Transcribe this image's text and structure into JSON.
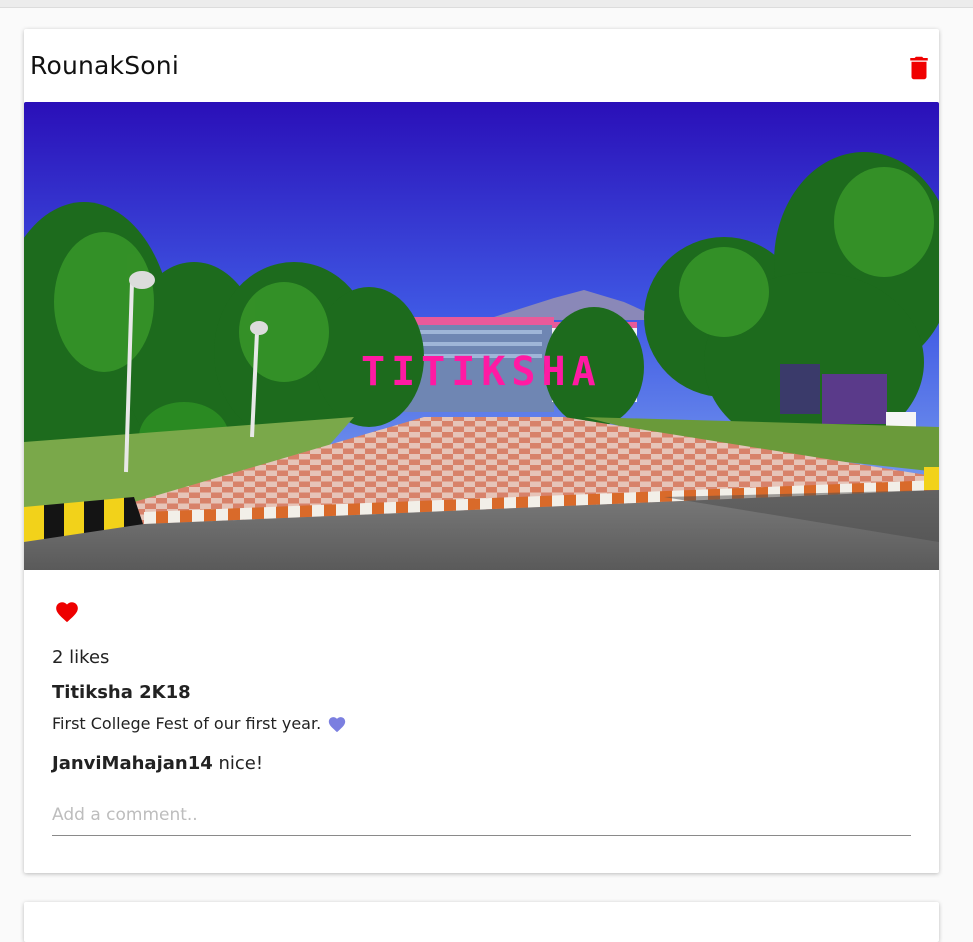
{
  "post": {
    "username": "RounakSoni",
    "photo_sign_text": "TITIKSHA",
    "likes_text": "2 likes",
    "caption_title": "Titiksha 2K18",
    "caption_text": "First College Fest of our first year.",
    "comments": [
      {
        "author": "JanviMahajan14",
        "text": "nice!"
      }
    ],
    "comment_placeholder": "Add a comment..",
    "icons": {
      "delete": "trash-icon",
      "like": "heart-icon",
      "caption_emoji": "purple-heart-emoji"
    },
    "colors": {
      "delete_icon": "#f00000",
      "like_icon": "#ee0000",
      "emoji_heart": "#7b7fe0",
      "sign_text": "#ff1aa3"
    }
  }
}
